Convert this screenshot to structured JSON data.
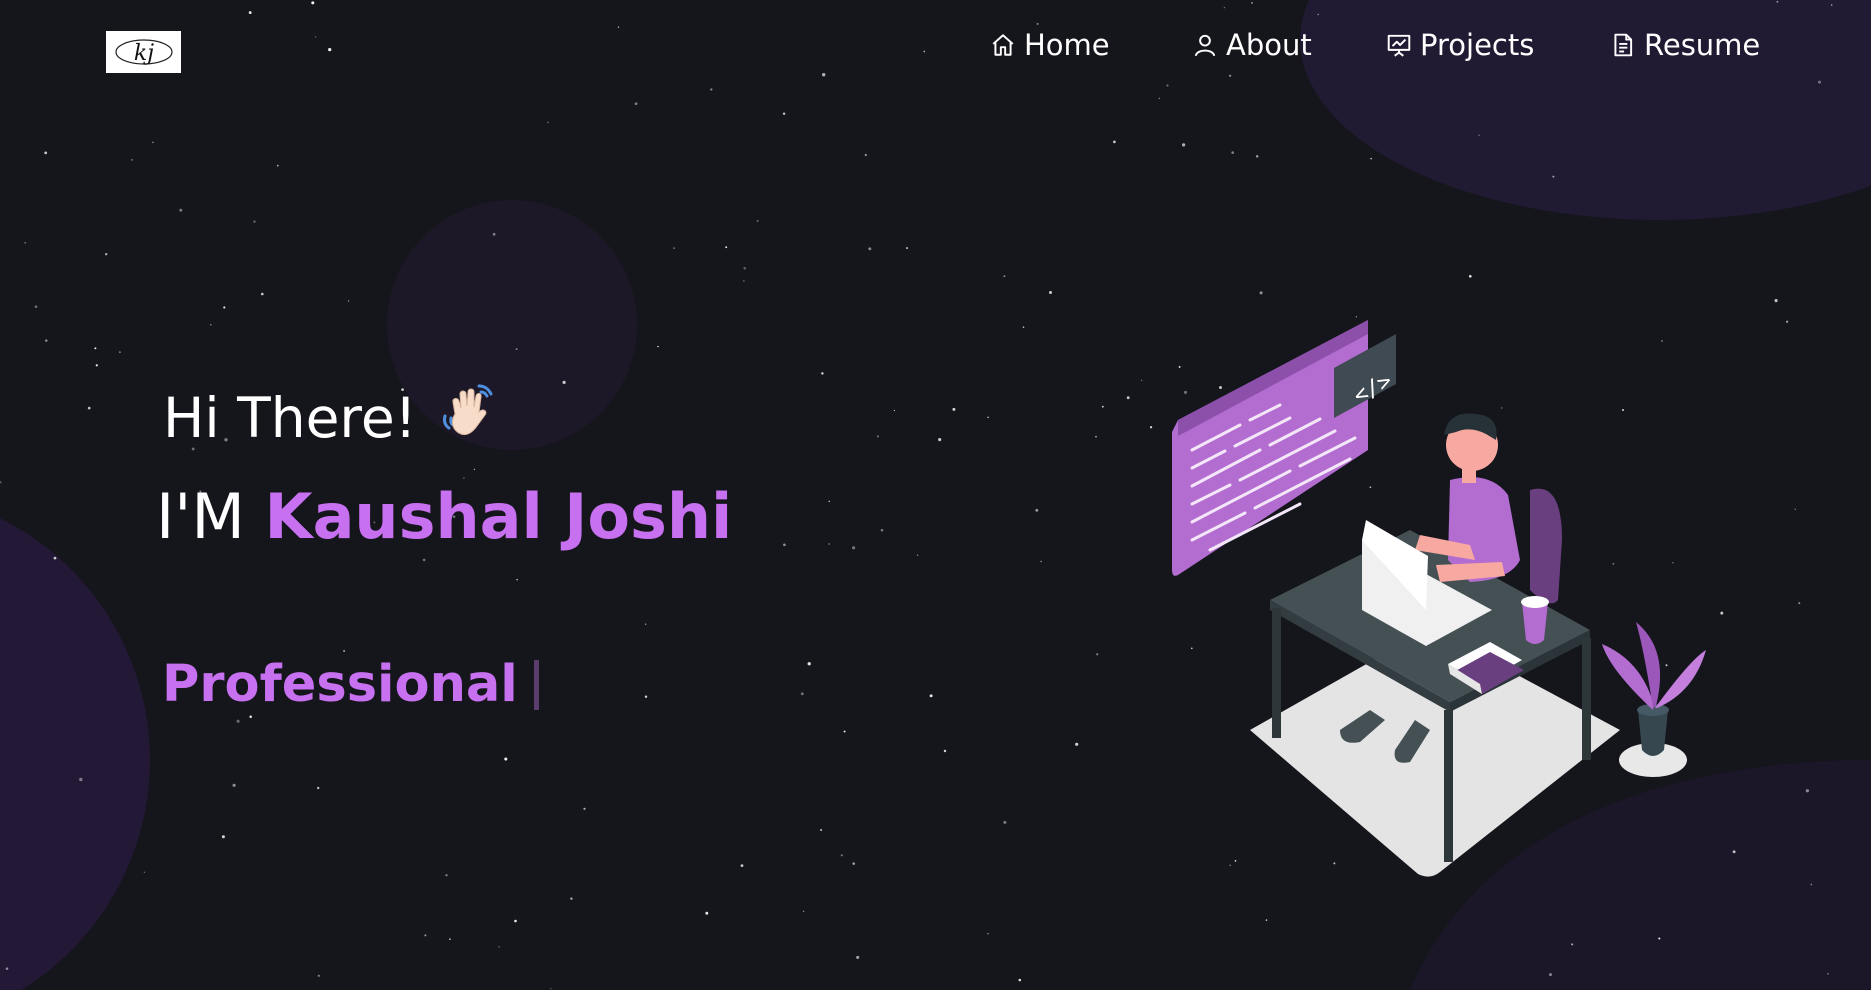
{
  "logo": {
    "text": "kj"
  },
  "nav": {
    "items": [
      {
        "label": "Home",
        "icon": "home-icon"
      },
      {
        "label": "About",
        "icon": "user-icon"
      },
      {
        "label": "Projects",
        "icon": "presentation-icon"
      },
      {
        "label": "Resume",
        "icon": "document-icon"
      }
    ]
  },
  "hero": {
    "greeting": "Hi There!",
    "wave_emoji": "👋🏻",
    "intro_prefix": "I'M",
    "name": "Kaushal Joshi",
    "typed_text": "Professional"
  },
  "colors": {
    "background": "#15151c",
    "accent": "#c770f0",
    "text": "#ffffff"
  }
}
